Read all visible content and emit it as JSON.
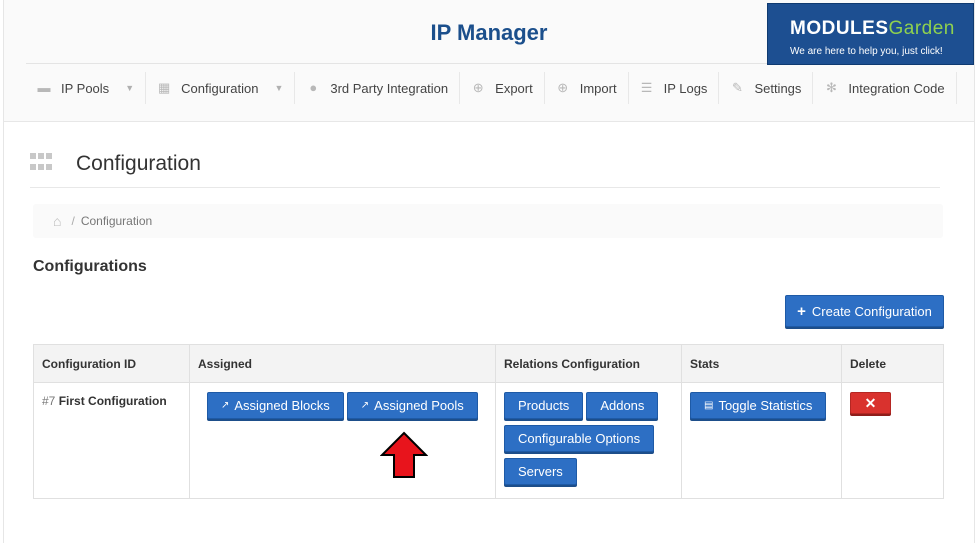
{
  "header": {
    "title": "IP Manager",
    "brand": {
      "logo_main": "MODULES",
      "logo_accent": "Garden",
      "tagline": "We are here to help you, just click!"
    }
  },
  "nav": [
    {
      "label": "IP Pools",
      "icon": "briefcase-icon",
      "dropdown": true
    },
    {
      "label": "Configuration",
      "icon": "grid-icon",
      "dropdown": true
    },
    {
      "label": "3rd Party Integration",
      "icon": "users-icon",
      "dropdown": false
    },
    {
      "label": "Export",
      "icon": "download-icon",
      "dropdown": false
    },
    {
      "label": "Import",
      "icon": "upload-icon",
      "dropdown": false
    },
    {
      "label": "IP Logs",
      "icon": "list-icon",
      "dropdown": false
    },
    {
      "label": "Settings",
      "icon": "wrench-icon",
      "dropdown": false
    },
    {
      "label": "Integration Code",
      "icon": "gears-icon",
      "dropdown": false
    }
  ],
  "page": {
    "title": "Configuration",
    "breadcrumb": [
      "Configuration"
    ],
    "section_title": "Configurations",
    "create_button": "Create Configuration"
  },
  "table": {
    "columns": [
      "Configuration ID",
      "Assigned",
      "Relations Configuration",
      "Stats",
      "Delete"
    ],
    "rows": [
      {
        "id_number": "#7",
        "name": "First Configuration",
        "assigned": [
          "Assigned Blocks",
          "Assigned Pools"
        ],
        "relations": [
          "Products",
          "Addons",
          "Configurable Options",
          "Servers"
        ],
        "stats": "Toggle Statistics",
        "delete": "✕"
      }
    ]
  },
  "colors": {
    "primary": "#2d6fc4",
    "danger": "#d9322e",
    "title": "#1b4f8c",
    "brand_bg": "#1d4f91",
    "arrow": "#e8141c"
  }
}
